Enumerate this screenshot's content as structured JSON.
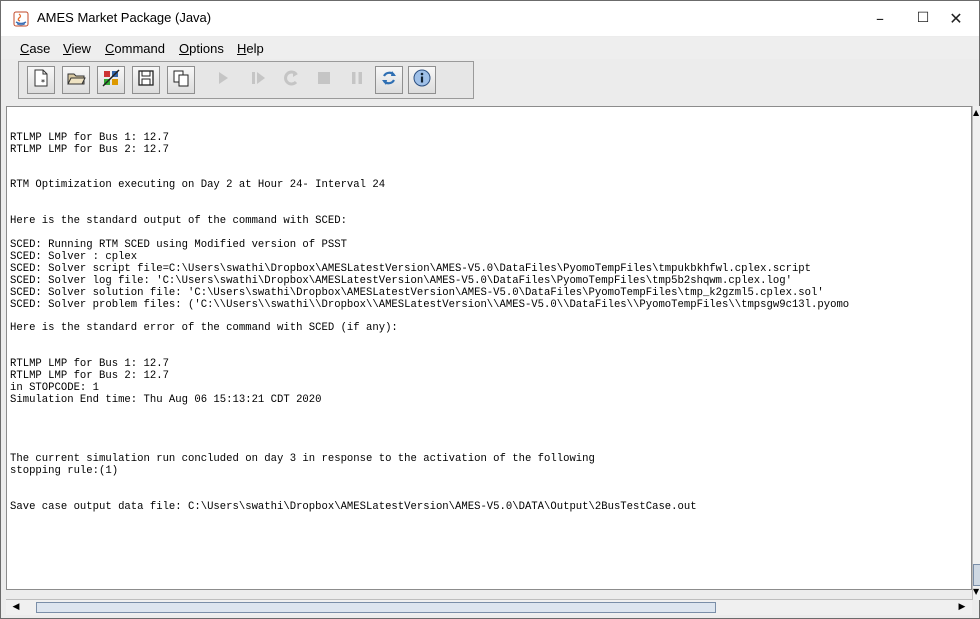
{
  "window": {
    "title": "AMES Market Package (Java)",
    "controls": {
      "minimize": "–",
      "maximize": "☐",
      "close": "✕"
    }
  },
  "menu": [
    "Case",
    "View",
    "Command",
    "Options",
    "Help"
  ],
  "toolbar": {
    "buttons": [
      {
        "name": "new-case-icon",
        "enabled": true
      },
      {
        "name": "open-case-icon",
        "enabled": true
      },
      {
        "name": "edit-case-icon",
        "enabled": true
      },
      {
        "name": "save-case-icon",
        "enabled": true
      },
      {
        "name": "copy-case-icon",
        "enabled": true
      },
      {
        "name": "run-icon",
        "enabled": false
      },
      {
        "name": "step-icon",
        "enabled": false
      },
      {
        "name": "restart-icon",
        "enabled": false
      },
      {
        "name": "stop-icon",
        "enabled": false
      },
      {
        "name": "pause-icon",
        "enabled": false
      },
      {
        "name": "refresh-icon",
        "enabled": true
      },
      {
        "name": "info-icon",
        "enabled": true
      }
    ]
  },
  "console": {
    "lines": [
      "",
      "",
      "RTLMP LMP for Bus 1: 12.7",
      "RTLMP LMP for Bus 2: 12.7",
      "",
      "",
      "RTM Optimization executing on Day 2 at Hour 24- Interval 24",
      "",
      "",
      "Here is the standard output of the command with SCED:",
      "",
      "SCED: Running RTM SCED using Modified version of PSST",
      "SCED: Solver : cplex",
      "SCED: Solver script file=C:\\Users\\swathi\\Dropbox\\AMESLatestVersion\\AMES-V5.0\\DataFiles\\PyomoTempFiles\\tmpukbkhfwl.cplex.script",
      "SCED: Solver log file: 'C:\\Users\\swathi\\Dropbox\\AMESLatestVersion\\AMES-V5.0\\DataFiles\\PyomoTempFiles\\tmp5b2shqwm.cplex.log'",
      "SCED: Solver solution file: 'C:\\Users\\swathi\\Dropbox\\AMESLatestVersion\\AMES-V5.0\\DataFiles\\PyomoTempFiles\\tmp_k2gzml5.cplex.sol'",
      "SCED: Solver problem files: ('C:\\\\Users\\\\swathi\\\\Dropbox\\\\AMESLatestVersion\\\\AMES-V5.0\\\\DataFiles\\\\PyomoTempFiles\\\\tmpsgw9c13l.pyomo",
      "",
      "Here is the standard error of the command with SCED (if any):",
      "",
      "",
      "RTLMP LMP for Bus 1: 12.7",
      "RTLMP LMP for Bus 2: 12.7",
      "in STOPCODE: 1",
      "Simulation End time: Thu Aug 06 15:13:21 CDT 2020",
      "",
      "",
      "",
      "",
      "The current simulation run concluded on day 3 in response to the activation of the following",
      "stopping rule:(1)",
      "",
      "",
      "Save case output data file: C:\\Users\\swathi\\Dropbox\\AMESLatestVersion\\AMES-V5.0\\DATA\\Output\\2BusTestCase.out"
    ]
  }
}
